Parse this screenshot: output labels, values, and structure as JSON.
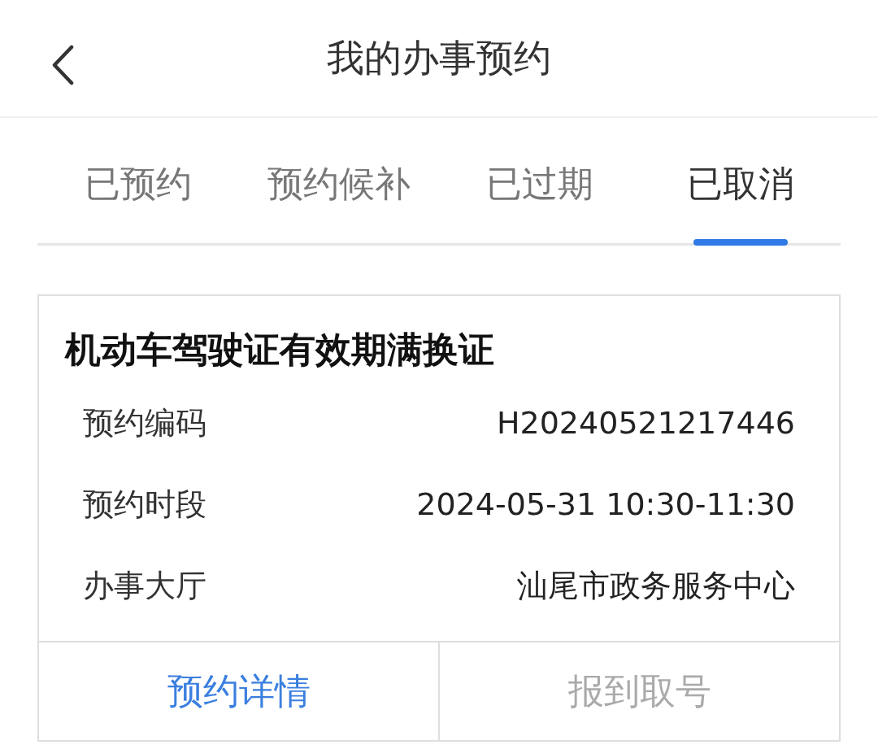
{
  "header": {
    "title": "我的办事预约"
  },
  "tabs": [
    {
      "label": "已预约",
      "selected": false
    },
    {
      "label": "预约候补",
      "selected": false
    },
    {
      "label": "已过期",
      "selected": false
    },
    {
      "label": "已取消",
      "selected": true
    }
  ],
  "card": {
    "title": "机动车驾驶证有效期满换证",
    "fields": [
      {
        "label": "预约编码",
        "value": "H20240521217446"
      },
      {
        "label": "预约时段",
        "value": "2024-05-31 10:30-11:30"
      },
      {
        "label": "办事大厅",
        "value": "汕尾市政务服务中心"
      }
    ],
    "actions": [
      {
        "label": "预约详情",
        "disabled": false
      },
      {
        "label": "报到取号",
        "disabled": true
      }
    ]
  }
}
